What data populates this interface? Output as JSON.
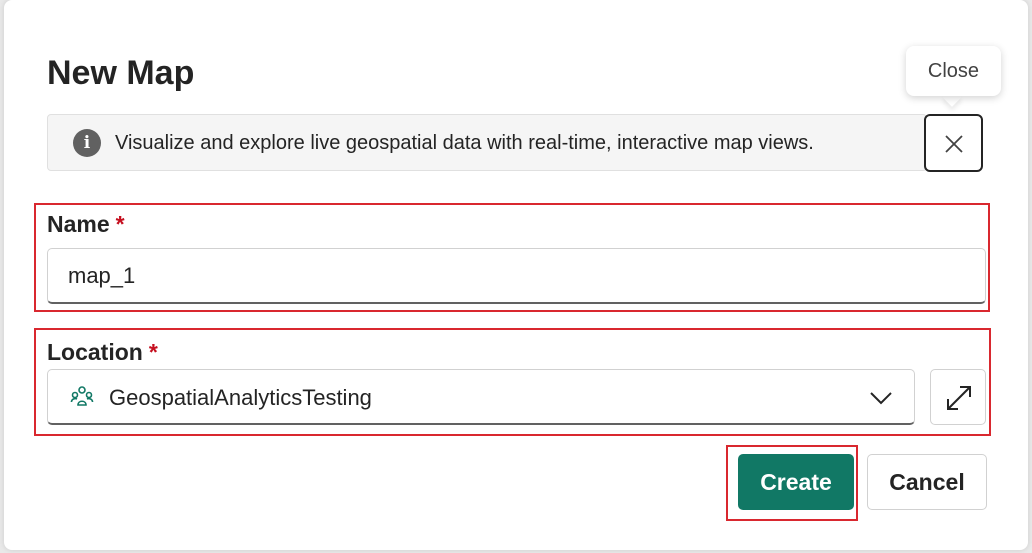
{
  "dialog": {
    "title": "New Map",
    "banner_text": "Visualize and explore live geospatial data with real-time, interactive map views.",
    "close_tooltip": "Close"
  },
  "fields": {
    "name": {
      "label": "Name",
      "required_marker": "*",
      "value": "map_1"
    },
    "location": {
      "label": "Location",
      "required_marker": "*",
      "value": "GeospatialAnalyticsTesting",
      "icon": "workspace-icon"
    }
  },
  "buttons": {
    "create": "Create",
    "cancel": "Cancel"
  },
  "colors": {
    "primary": "#117865",
    "required": "#c50f1f",
    "highlight": "#d9282f"
  },
  "icons": [
    "info-icon",
    "close-icon",
    "workspace-icon",
    "chevron-down-icon",
    "expand-icon"
  ]
}
